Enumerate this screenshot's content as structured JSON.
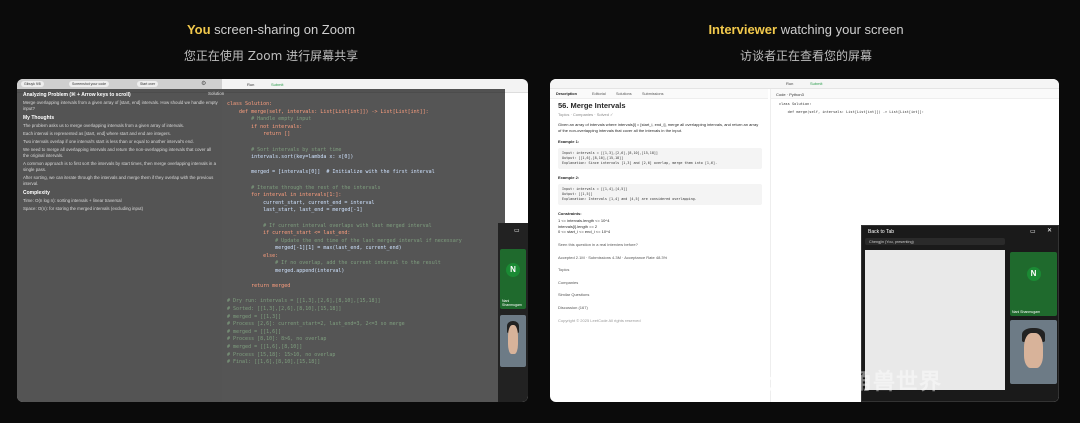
{
  "headers": {
    "left": {
      "highlight": "You",
      "rest": " screen-sharing on Zoom",
      "zh": "您正在使用 Zoom 进行屏幕共享"
    },
    "right": {
      "highlight": "Interviewer",
      "rest": " watching your screen",
      "zh": "访谈者正在查看您的屏幕"
    }
  },
  "colors": {
    "highlight": "#f2c94c",
    "zoom_green": "#1b8a34"
  },
  "left_shot": {
    "pills": [
      "Gibuyk 9/8",
      "Screenshot your code",
      "Start over"
    ],
    "run": "Run",
    "submit": "Submit",
    "solution_label": "Solution",
    "overlay": {
      "title": "Analyzing Problem (⌘ + Arrow keys to scroll)",
      "desc": "Merge overlapping intervals from a given array of [start, end] intervals. How should we handle empty input?",
      "thoughts_h": "My Thoughts",
      "thoughts": [
        "The problem asks us to merge overlapping intervals from a given array of intervals.",
        "Each interval is represented as [start, end] where start and end are integers.",
        "Two intervals overlap if one interval's start is less than or equal to another interval's end.",
        "We need to merge all overlapping intervals and return the non-overlapping intervals that cover all the original intervals.",
        "A common approach is to first sort the intervals by start times, then merge overlapping intervals in a single pass.",
        "After sorting, we can iterate through the intervals and merge them if they overlap with the previous interval."
      ],
      "complexity_h": "Complexity",
      "time": "Time: O(n log n): sorting intervals + linear traversal",
      "space": "Space: O(n): for storing the merged intervals (excluding input)"
    },
    "code": [
      "class Solution:",
      "    def merge(self, intervals: List[List[int]]) -> List[List[int]]:",
      "        # Handle empty input",
      "        if not intervals:",
      "            return []",
      "",
      "        # Sort intervals by start time",
      "        intervals.sort(key=lambda x: x[0])",
      "",
      "        merged = [intervals[0]]  # Initialize with the first interval",
      "",
      "        # Iterate through the rest of the intervals",
      "        for interval in intervals[1:]:",
      "            current_start, current_end = interval",
      "            last_start, last_end = merged[-1]",
      "",
      "            # If current interval overlaps with last merged interval",
      "            if current_start <= last_end:",
      "                # Update the end time of the last merged interval if necessary",
      "                merged[-1][1] = max(last_end, current_end)",
      "            else:",
      "                # If no overlap, add the current interval to the result",
      "                merged.append(interval)",
      "",
      "        return merged",
      "",
      "# Dry run: intervals = [[1,3],[2,6],[8,10],[15,18]]",
      "# Sorted: [[1,3],[2,6],[8,10],[15,18]]",
      "# merged = [[1,3]]",
      "# Process [2,6]: current_start=2, last_end=3, 2<=3 so merge",
      "# merged = [[1,6]]",
      "# Process [8,10]: 8>6, no overlap",
      "# merged = [[1,6],[8,10]]",
      "# Process [15,18]: 15>10, no overlap",
      "# Final: [[1,6],[8,10],[15,18]]"
    ],
    "participant": "Nani Shanmugam"
  },
  "right_shot": {
    "tabs": [
      "Description",
      "Editorial",
      "Solutions",
      "Submissions"
    ],
    "run": "Run",
    "submit": "Submit",
    "problem_title": "56. Merge Intervals",
    "solved": "Solved ✓",
    "tags": [
      "Topics",
      "Companies"
    ],
    "statement": "Given an array of intervals where intervals[i] = [start_i, end_i], merge all overlapping intervals, and return an array of the non-overlapping intervals that cover all the intervals in the input.",
    "ex1_h": "Example 1:",
    "ex1": "Input: intervals = [[1,3],[2,6],[8,10],[15,18]]\nOutput: [[1,6],[8,10],[15,18]]\nExplanation: Since intervals [1,3] and [2,6] overlap, merge them into [1,6].",
    "ex2_h": "Example 2:",
    "ex2": "Input: intervals = [[1,4],[4,5]]\nOutput: [[1,5]]\nExplanation: Intervals [1,4] and [4,5] are considered overlapping.",
    "constraints_h": "Constraints:",
    "constraints": [
      "1 <= intervals.length <= 10^4",
      "intervals[i].length == 2",
      "0 <= start_i <= end_i <= 10^4"
    ],
    "seen": "Seen this question in a real interview before?",
    "accepted": "Accepted 2.1M",
    "submissions": "Submissions 4.3M",
    "rate": "Acceptance Rate 48.3%",
    "links": [
      "Topics",
      "Companies",
      "Similar Questions",
      "Discussion (167)"
    ],
    "copyright": "Copyright © 2025 LeetCode All rights reserved",
    "code_hd": "Code",
    "code_lang": "Python3",
    "code": [
      "class Solution:",
      "    def merge(self, intervals: List[List[int]]) -> List[List[int]]:",
      "        "
    ],
    "zoom": {
      "back": "Back to Tab",
      "presenting": "Chengjin (You, presenting)",
      "participant": "Nani Shanmugam"
    }
  },
  "watermark": {
    "a": "公众号",
    "b": "独角兽世界"
  }
}
